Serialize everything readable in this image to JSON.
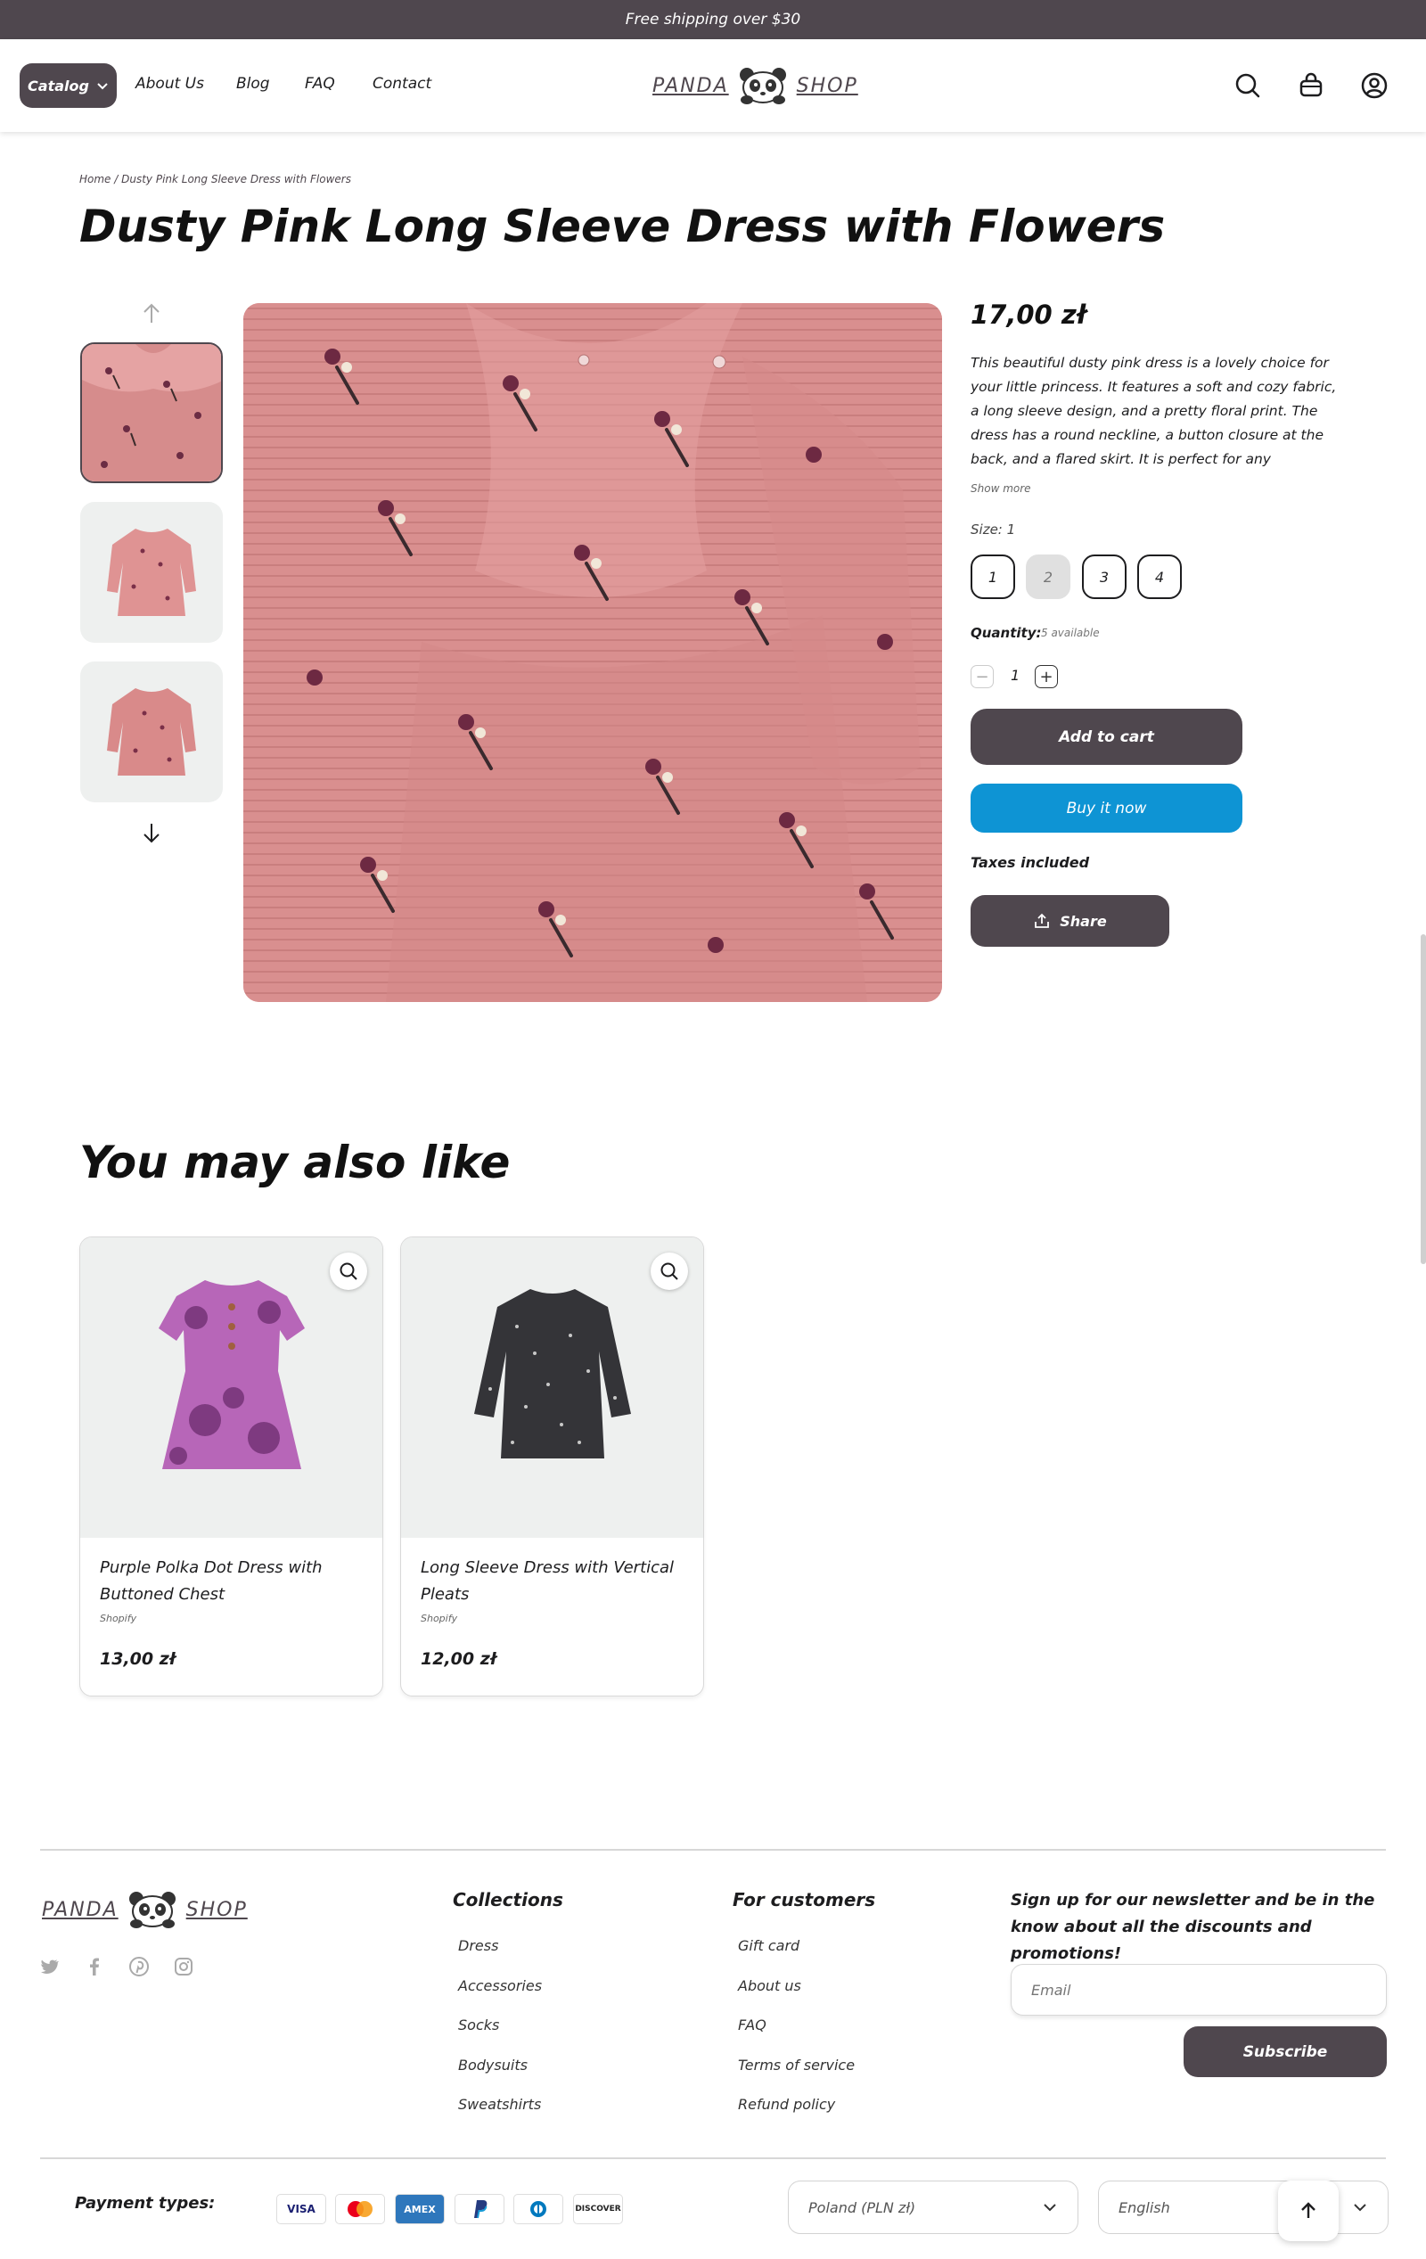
{
  "announcement": "Free shipping over $30",
  "header": {
    "catalog": "Catalog",
    "nav": [
      "About Us",
      "Blog",
      "FAQ",
      "Contact"
    ],
    "logo_left": "PANDA",
    "logo_right": "SHOP"
  },
  "breadcrumb": "Home / Dusty Pink Long Sleeve Dress with Flowers",
  "product": {
    "title": "Dusty Pink Long Sleeve Dress with Flowers",
    "price": "17,00 zł",
    "description": "This beautiful dusty pink dress is a lovely choice for your little princess. It features a soft and cozy fabric, a long sleeve design, and a pretty floral print. The dress has a round neckline, a button closure at the back, and a flared skirt. It is perfect for any occasion,",
    "show_more": "Show more",
    "size_label": "Size: 1",
    "sizes": [
      "1",
      "2",
      "3",
      "4"
    ],
    "quantity_label": "Quantity:",
    "quantity_available": "5 available",
    "quantity": "1",
    "add_to_cart": "Add to cart",
    "buy_now": "Buy it now",
    "taxes": "Taxes included",
    "share": "Share"
  },
  "recommendations": {
    "title": "You may also like",
    "items": [
      {
        "name": "Purple Polka Dot Dress with Buttoned Chest",
        "vendor": "Shopify",
        "price": "13,00 zł"
      },
      {
        "name": "Long Sleeve Dress with Vertical Pleats",
        "vendor": "Shopify",
        "price": "12,00 zł"
      }
    ]
  },
  "footer": {
    "collections_title": "Collections",
    "collections": [
      "Dress",
      "Accessories",
      "Socks",
      "Bodysuits",
      "Sweatshirts"
    ],
    "customers_title": "For customers",
    "customers": [
      "Gift card",
      "About us",
      "FAQ",
      "Terms of service",
      "Refund policy"
    ],
    "newsletter_text": "Sign up for our newsletter and be in the know about all the discounts and promotions!",
    "email_placeholder": "Email",
    "subscribe": "Subscribe",
    "payment_label": "Payment types:",
    "payments": [
      "VISA",
      "mastercard",
      "AMEX",
      "paypal",
      "diners",
      "DISCOVER"
    ],
    "country": "Poland (PLN zł)",
    "language": "English"
  },
  "colors": {
    "brand": "#4f474e",
    "buy_now": "#0e94d4",
    "product_pink": "#d99090"
  }
}
